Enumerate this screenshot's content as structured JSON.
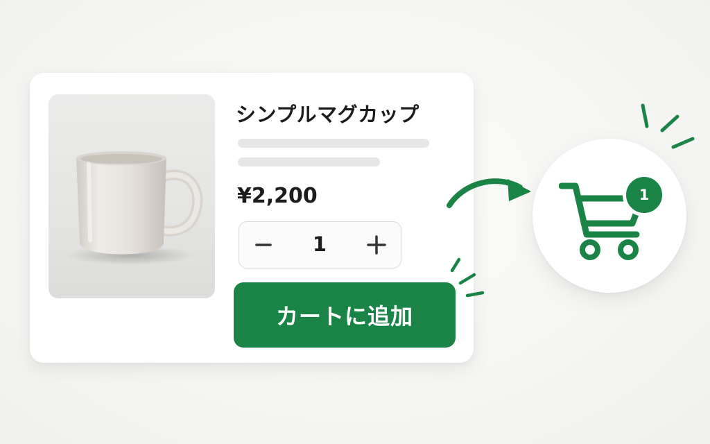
{
  "product": {
    "title": "シンプルマグカップ",
    "price": "¥2,200",
    "image": "white-ceramic-mug"
  },
  "quantity": {
    "value": "1",
    "decrement_icon": "minus-icon",
    "increment_icon": "plus-icon"
  },
  "add_to_cart": {
    "label": "カートに追加"
  },
  "cart": {
    "icon": "shopping-cart-icon",
    "badge_count": "1"
  },
  "colors": {
    "accent": "#1a8446",
    "background": "#f6f6f4",
    "card": "#ffffff",
    "text": "#1c1c1c",
    "placeholder_line": "#e6e6e6"
  }
}
